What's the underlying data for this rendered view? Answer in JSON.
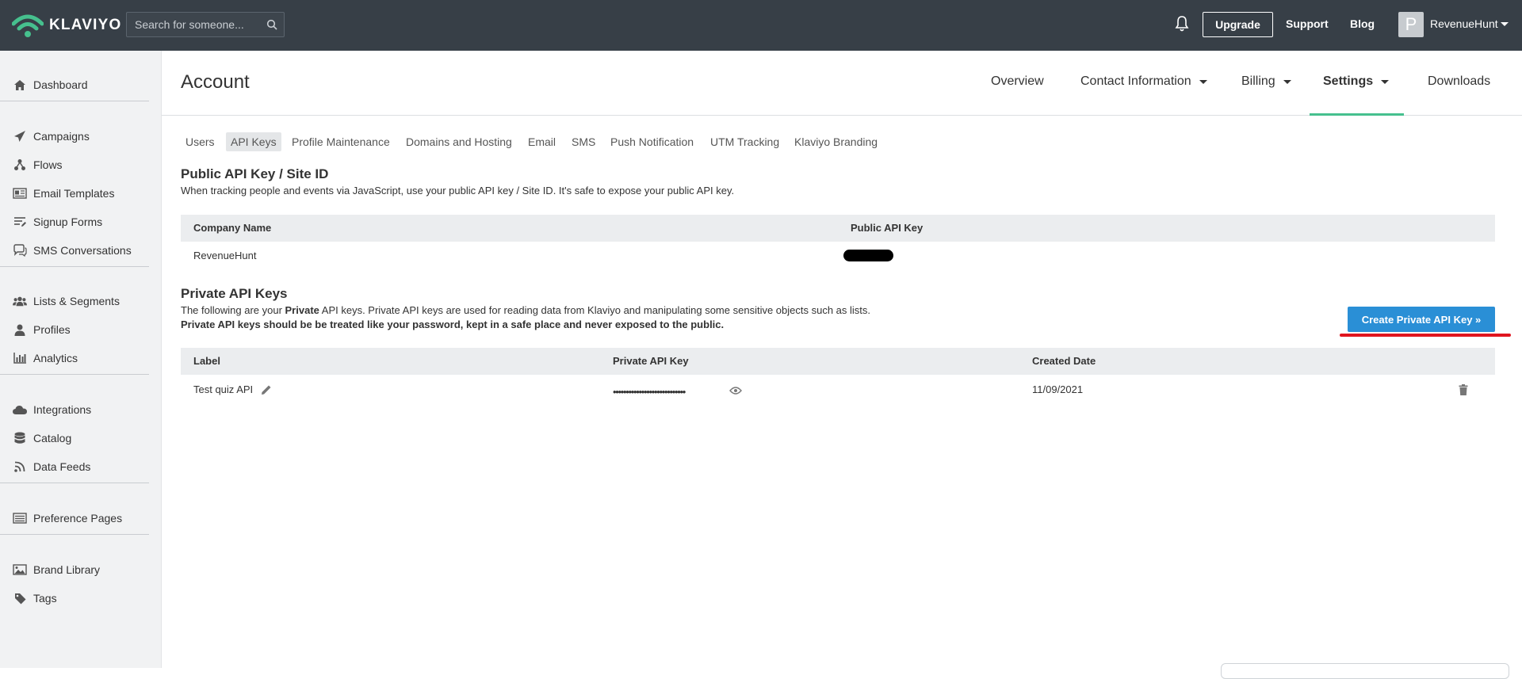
{
  "brand": {
    "name": "KLAVIYO",
    "accent": "#46c08e"
  },
  "topbar": {
    "search_placeholder": "Search for someone...",
    "upgrade_label": "Upgrade",
    "support_label": "Support",
    "blog_label": "Blog",
    "avatar_letter": "P",
    "account_name": "RevenueHunt"
  },
  "sidebar": {
    "items": [
      {
        "label": "Dashboard",
        "icon": "home-icon"
      },
      {
        "label": "Campaigns",
        "icon": "paper-plane-icon"
      },
      {
        "label": "Flows",
        "icon": "flow-icon"
      },
      {
        "label": "Email Templates",
        "icon": "email-template-icon"
      },
      {
        "label": "Signup Forms",
        "icon": "form-icon"
      },
      {
        "label": "SMS Conversations",
        "icon": "chat-icon"
      },
      {
        "label": "Lists & Segments",
        "icon": "users-icon"
      },
      {
        "label": "Profiles",
        "icon": "person-icon"
      },
      {
        "label": "Analytics",
        "icon": "bar-chart-icon"
      },
      {
        "label": "Integrations",
        "icon": "cloud-icon"
      },
      {
        "label": "Catalog",
        "icon": "database-icon"
      },
      {
        "label": "Data Feeds",
        "icon": "rss-icon"
      },
      {
        "label": "Preference Pages",
        "icon": "list-page-icon"
      },
      {
        "label": "Brand Library",
        "icon": "image-icon"
      },
      {
        "label": "Tags",
        "icon": "tag-icon"
      }
    ]
  },
  "account": {
    "title": "Account",
    "nav": [
      {
        "label": "Overview"
      },
      {
        "label": "Contact Information"
      },
      {
        "label": "Billing"
      },
      {
        "label": "Settings"
      },
      {
        "label": "Downloads"
      }
    ],
    "subtabs": [
      {
        "label": "Users"
      },
      {
        "label": "API Keys"
      },
      {
        "label": "Profile Maintenance"
      },
      {
        "label": "Domains and Hosting"
      },
      {
        "label": "Email"
      },
      {
        "label": "SMS"
      },
      {
        "label": "Push Notification"
      },
      {
        "label": "UTM Tracking"
      },
      {
        "label": "Klaviyo Branding"
      }
    ]
  },
  "public_keys": {
    "title": "Public API Key / Site ID",
    "description": "When tracking people and events via JavaScript, use your public API key / Site ID. It's safe to expose your public API key.",
    "columns": [
      "Company Name",
      "Public API Key"
    ],
    "row": {
      "company": "RevenueHunt"
    }
  },
  "private_keys": {
    "title": "Private API Keys",
    "desc_prefix": "The following are your ",
    "desc_bold": "Private",
    "desc_suffix": " API keys. Private API keys are used for reading data from Klaviyo and manipulating some sensitive objects such as lists.",
    "warning": "Private API keys should be be treated like your password, kept in a safe place and never exposed to the public.",
    "create_label": "Create Private API Key »",
    "columns": [
      "Label",
      "Private API Key",
      "Created Date"
    ],
    "rows": [
      {
        "label": "Test quiz API",
        "key_masked": "••••••••••••••••••••••••••••",
        "created": "11/09/2021"
      }
    ]
  }
}
